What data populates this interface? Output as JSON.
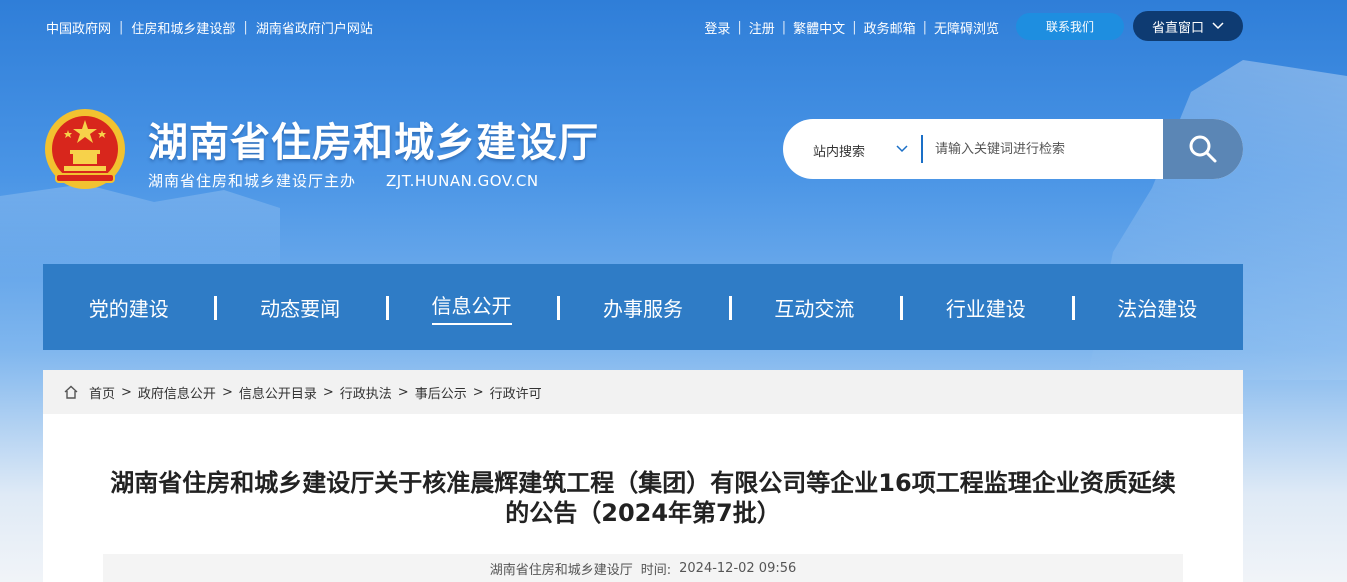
{
  "top_left_links": [
    "中国政府网",
    "住房和城乡建设部",
    "湖南省政府门户网站"
  ],
  "top_right_links": [
    "登录",
    "注册",
    "繁體中文",
    "政务邮箱",
    "无障碍浏览"
  ],
  "contact_label": "联系我们",
  "window_label": "省直窗口",
  "site": {
    "title": "湖南省住房和城乡建设厅",
    "subtitle": "湖南省住房和城乡建设厅主办",
    "domain": "ZJT.HUNAN.GOV.CN"
  },
  "search": {
    "scope": "站内搜索",
    "placeholder": "请输入关键词进行检索"
  },
  "nav": [
    "党的建设",
    "动态要闻",
    "信息公开",
    "办事服务",
    "互动交流",
    "行业建设",
    "法治建设"
  ],
  "nav_active_index": 2,
  "breadcrumb": [
    "首页",
    "政府信息公开",
    "信息公开目录",
    "行政执法",
    "事后公示",
    "行政许可"
  ],
  "article": {
    "title": "湖南省住房和城乡建设厅关于核准晨辉建筑工程（集团）有限公司等企业16项工程监理企业资质延续的公告（2024年第7批）",
    "source": "湖南省住房和城乡建设厅",
    "time_label": "时间:",
    "time": "2024-12-02 09:56"
  }
}
